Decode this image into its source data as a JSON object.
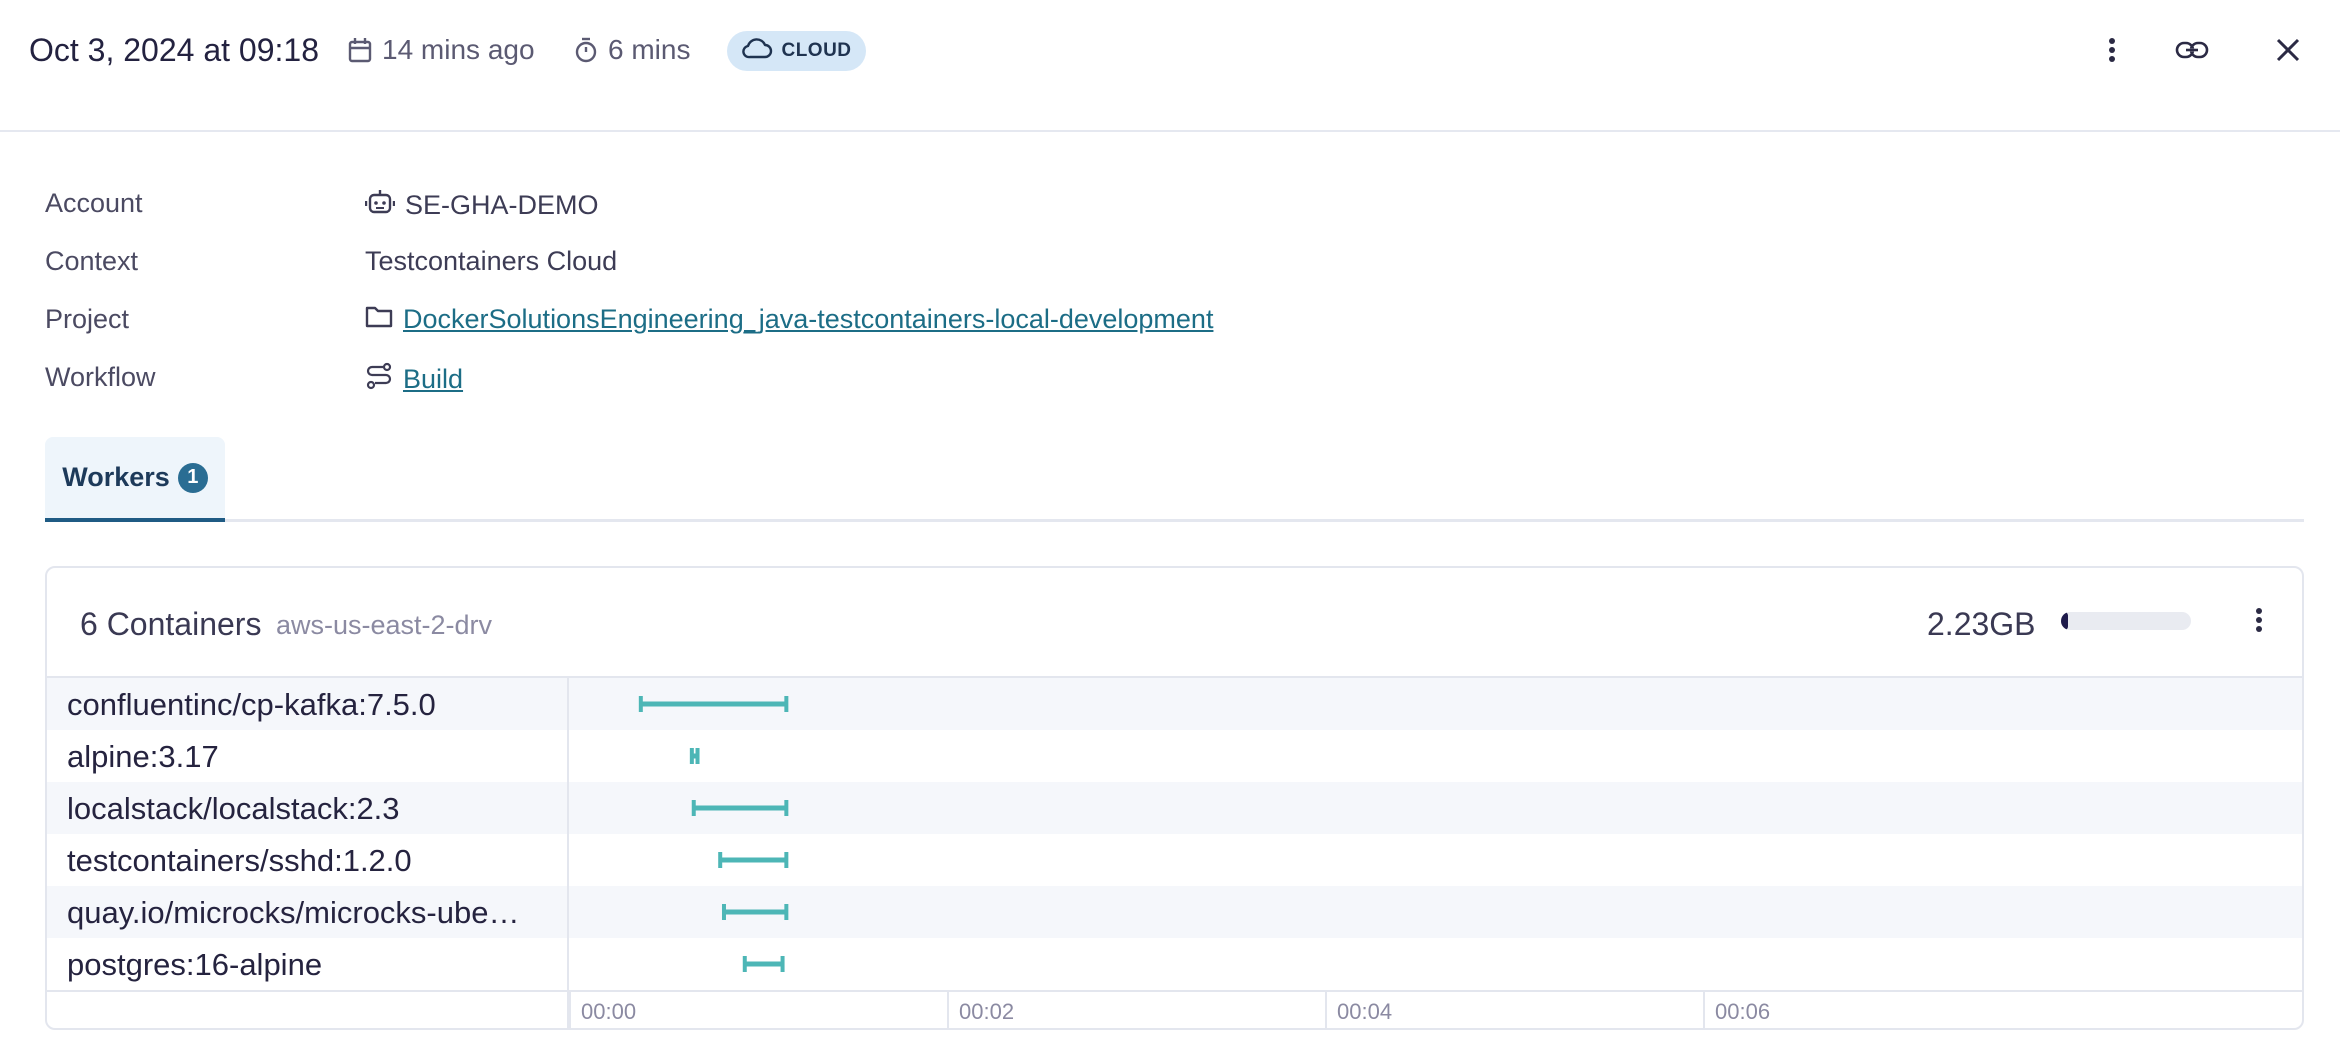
{
  "header": {
    "title": "Oct 3, 2024 at 09:18",
    "relative_time": "14 mins ago",
    "duration": "6 mins",
    "badge": "CLOUD",
    "icons": [
      "calendar-icon",
      "stopwatch-icon",
      "cloud-icon",
      "more-vertical-icon",
      "link-icon",
      "close-icon"
    ]
  },
  "details": {
    "account": {
      "label": "Account",
      "value": "SE-GHA-DEMO"
    },
    "context": {
      "label": "Context",
      "value": "Testcontainers Cloud"
    },
    "project": {
      "label": "Project",
      "value": "DockerSolutionsEngineering_java-testcontainers-local-development"
    },
    "workflow": {
      "label": "Workflow",
      "value": "Build"
    }
  },
  "tabs": [
    {
      "label": "Workers",
      "count": "1",
      "active": true
    }
  ],
  "worker_card": {
    "title": "6 Containers",
    "region": "aws-us-east-2-drv",
    "memory": "2.23GB",
    "memory_usage_fraction": 0.05,
    "axis_ticks": [
      "00:00",
      "00:02",
      "00:04",
      "00:06"
    ],
    "containers": [
      {
        "name": "confluentinc/cp-kafka:7.5.0",
        "start": 0.38,
        "end": 1.15
      },
      {
        "name": "alpine:3.17",
        "start": 0.65,
        "end": 0.68
      },
      {
        "name": "localstack/localstack:2.3",
        "start": 0.66,
        "end": 1.15
      },
      {
        "name": "testcontainers/sshd:1.2.0",
        "start": 0.8,
        "end": 1.15
      },
      {
        "name": "quay.io/microcks/microcks-ube…",
        "start": 0.82,
        "end": 1.15
      },
      {
        "name": "postgres:16-alpine",
        "start": 0.93,
        "end": 1.13
      }
    ]
  },
  "colors": {
    "accent": "#1c6d86",
    "bar": "#4db6b6",
    "badge_bg": "#d5e7f7",
    "tab_bg": "#eef5fb"
  }
}
